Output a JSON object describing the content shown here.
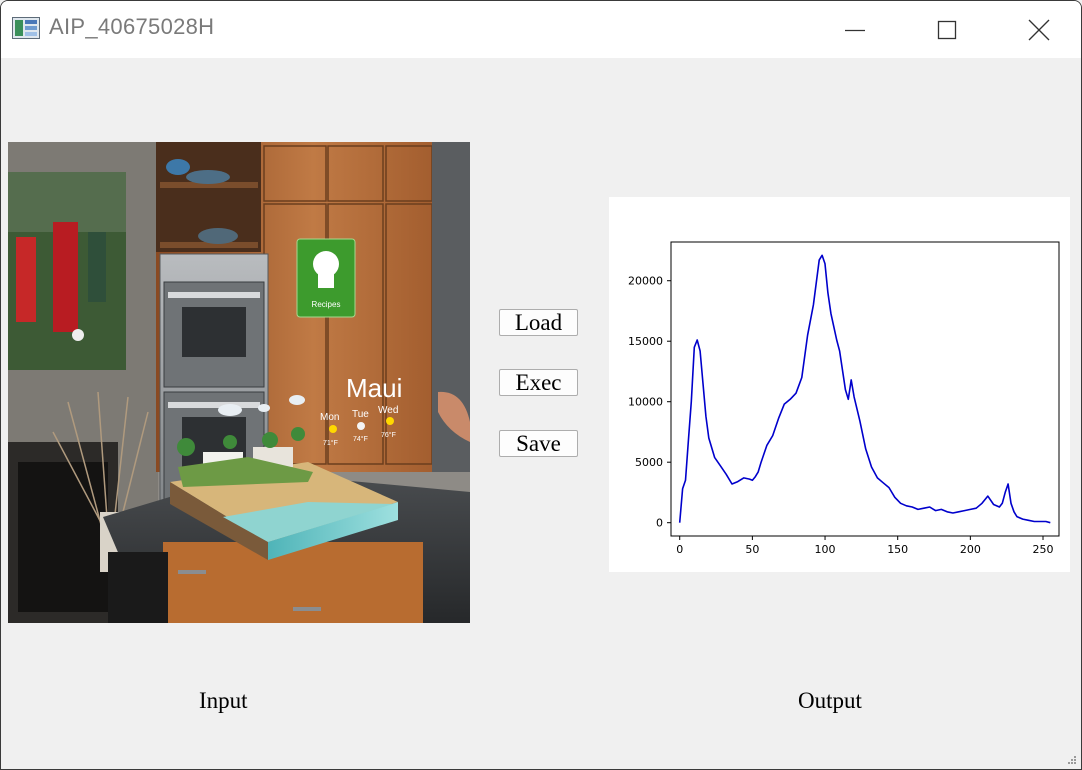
{
  "window": {
    "title": "AIP_40675028H"
  },
  "buttons": {
    "load": "Load",
    "exec": "Exec",
    "save": "Save"
  },
  "labels": {
    "input": "Input",
    "output": "Output"
  },
  "input_image": {
    "overlay": {
      "recipes": "Recipes",
      "city": "Maui",
      "days": [
        "Mon",
        "Tue",
        "Wed"
      ],
      "temps": [
        "71°F",
        "74°F",
        "76°F"
      ]
    }
  },
  "colors": {
    "plot_line": "#0000cc",
    "background": "#f0f0f0"
  },
  "chart_data": {
    "type": "line",
    "xlim": [
      -6,
      261
    ],
    "ylim": [
      -1100,
      23200
    ],
    "xticks": [
      0,
      50,
      100,
      150,
      200,
      250
    ],
    "yticks": [
      0,
      5000,
      10000,
      15000,
      20000
    ],
    "grid": false,
    "series": [
      {
        "x": [
          0,
          2,
          4,
          6,
          8,
          10,
          12,
          14,
          16,
          18,
          20,
          24,
          28,
          32,
          36,
          40,
          44,
          48,
          50,
          52,
          54,
          56,
          60,
          64,
          68,
          72,
          76,
          80,
          84,
          88,
          92,
          96,
          98,
          100,
          102,
          104,
          106,
          108,
          110,
          112,
          114,
          116,
          118,
          120,
          124,
          128,
          132,
          136,
          140,
          144,
          148,
          152,
          156,
          160,
          164,
          168,
          172,
          176,
          180,
          184,
          188,
          192,
          196,
          200,
          204,
          208,
          212,
          216,
          220,
          222,
          224,
          226,
          228,
          230,
          232,
          236,
          240,
          244,
          248,
          252,
          255
        ],
        "values": [
          0,
          2800,
          3500,
          6800,
          10000,
          14500,
          15100,
          14200,
          11500,
          8800,
          7000,
          5400,
          4700,
          4000,
          3200,
          3400,
          3700,
          3600,
          3500,
          3800,
          4200,
          5000,
          6400,
          7200,
          8600,
          9800,
          10200,
          10700,
          12000,
          15500,
          18000,
          21700,
          22100,
          21400,
          19000,
          17300,
          16200,
          15100,
          14200,
          12600,
          11000,
          10200,
          11800,
          10400,
          8400,
          6100,
          4600,
          3700,
          3300,
          2900,
          2100,
          1600,
          1400,
          1300,
          1100,
          1200,
          1300,
          1000,
          1100,
          900,
          800,
          900,
          1000,
          1100,
          1200,
          1600,
          2200,
          1500,
          1300,
          1600,
          2500,
          3200,
          1600,
          900,
          500,
          300,
          200,
          100,
          100,
          100,
          0
        ]
      }
    ]
  }
}
